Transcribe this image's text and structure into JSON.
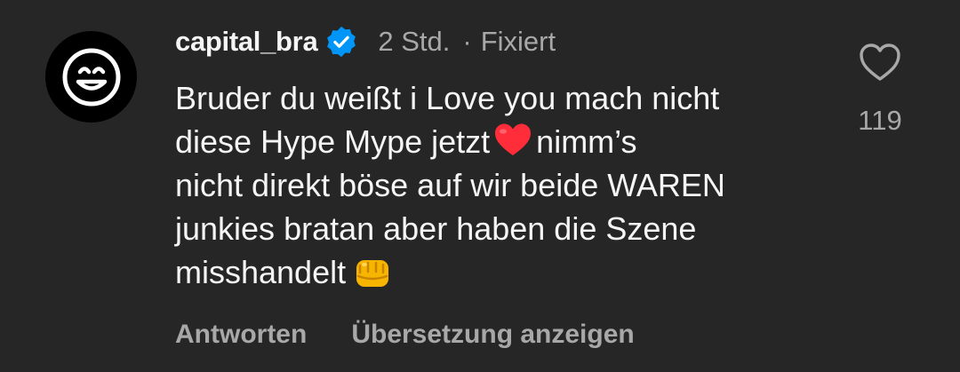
{
  "comment": {
    "username": "capital_bra",
    "time": "2 Std.",
    "separator": "·",
    "pinned_label": "Fixiert",
    "text_lines": [
      "Bruder du weißt i Love you mach nicht",
      "diese Hype Mype jetzt",
      "nimm’s",
      "nicht direkt böse auf wir beide WAREN",
      "junkies bratan aber haben die Szene",
      "misshandelt"
    ],
    "like_count": "119",
    "reply_label": "Antworten",
    "translate_label": "Übersetzung anzeigen"
  },
  "colors": {
    "background": "#262626",
    "text_primary": "#f5f5f5",
    "text_secondary": "#a8a8a8",
    "verified_blue": "#0095f6",
    "heart_red": "#ff2d3a"
  },
  "icons": {
    "avatar": "smiling-face-icon",
    "verified": "verified-badge-icon",
    "heart_emoji": "red-heart-emoji",
    "fist_emoji": "oncoming-fist-emoji",
    "like": "heart-outline-icon"
  }
}
